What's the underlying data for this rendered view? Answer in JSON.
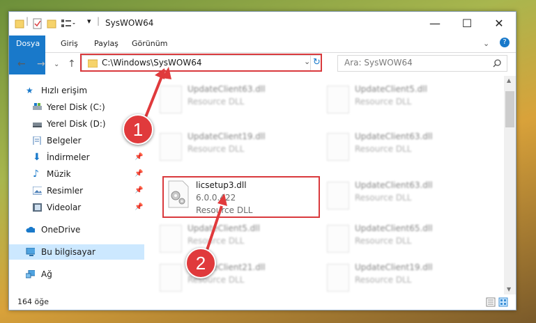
{
  "window": {
    "title": "SysWOW64",
    "controls": {
      "minimize": "—",
      "maximize": "☐",
      "close": "✕"
    }
  },
  "ribbon": {
    "tabs": [
      "Dosya",
      "Giriş",
      "Paylaş",
      "Görünüm"
    ]
  },
  "nav": {
    "address": "C:\\Windows\\SysWOW64",
    "search_placeholder": "Ara: SysWOW64"
  },
  "sidebar": {
    "items": [
      {
        "label": "Hızlı erişim",
        "icon": "star-icon"
      },
      {
        "label": "Yerel Disk (C:)",
        "icon": "drive-icon"
      },
      {
        "label": "Yerel Disk (D:)",
        "icon": "drive-icon"
      },
      {
        "label": "Belgeler",
        "icon": "document-icon"
      },
      {
        "label": "İndirmeler",
        "icon": "download-icon"
      },
      {
        "label": "Müzik",
        "icon": "music-icon"
      },
      {
        "label": "Resimler",
        "icon": "pictures-icon"
      },
      {
        "label": "Videolar",
        "icon": "video-icon"
      },
      {
        "label": "OneDrive",
        "icon": "cloud-icon"
      },
      {
        "label": "Bu bilgisayar",
        "icon": "computer-icon"
      },
      {
        "label": "Ağ",
        "icon": "network-icon"
      }
    ]
  },
  "files": [
    {
      "name": "UpdateClient63.dll",
      "type": "Resource DLL"
    },
    {
      "name": "UpdateClient5.dll",
      "type": "Resource DLL"
    },
    {
      "name": "UpdateClient19.dll",
      "type": "Resource DLL"
    },
    {
      "name": "UpdateClient63.dll",
      "type": "Resource DLL"
    },
    {
      "name": "licsetup3.dll",
      "version": "6.0.0.422",
      "type": "Resource DLL"
    },
    {
      "name": "UpdateClient63.dll",
      "type": "Resource DLL"
    },
    {
      "name": "UpdateClient5.dll",
      "type": "Resource DLL"
    },
    {
      "name": "UpdateClient65.dll",
      "type": "Resource DLL"
    },
    {
      "name": "UpdateClient21.dll",
      "type": "Resource DLL"
    },
    {
      "name": "UpdateClient19.dll",
      "type": "Resource DLL"
    }
  ],
  "status": {
    "count": "164 öğe"
  },
  "callouts": [
    "1",
    "2"
  ],
  "colors": {
    "accent": "#1979ca",
    "highlight": "#d9393c",
    "selection": "#cce8ff"
  }
}
